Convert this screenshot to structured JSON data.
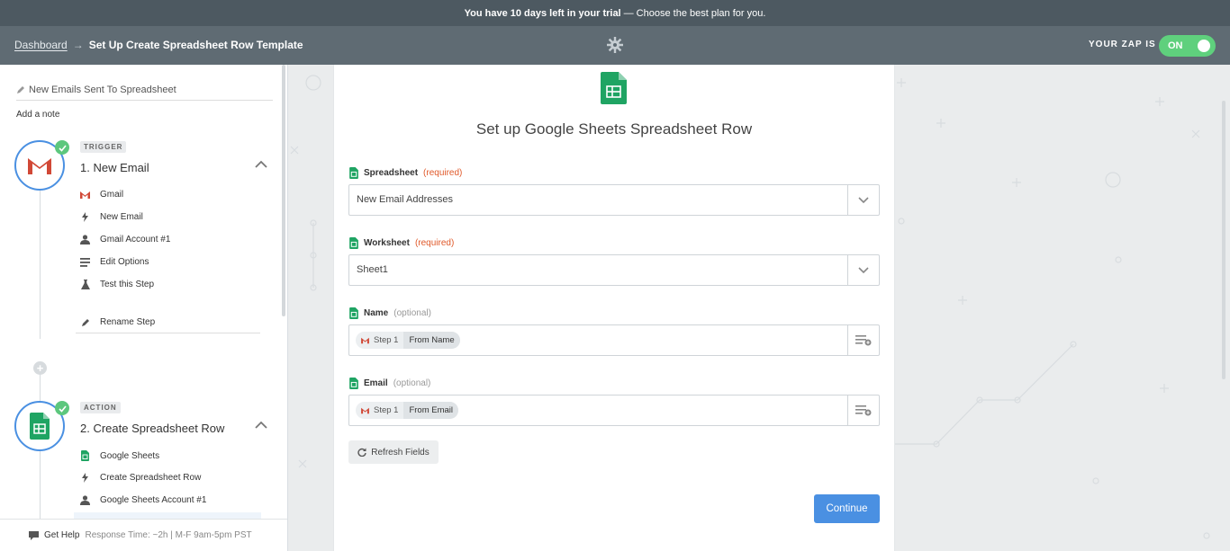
{
  "trial": {
    "bold": "You have 10 days left in your trial",
    "rest": "— Choose the best plan for you."
  },
  "header": {
    "dashboard": "Dashboard",
    "arrow": "→",
    "title": "Set Up Create Spreadsheet Row Template",
    "zap_is": "YOUR ZAP IS",
    "toggle": "ON"
  },
  "sidebar": {
    "zap_name": "New Emails Sent To Spreadsheet",
    "add_note": "Add a note",
    "step1": {
      "badge": "TRIGGER",
      "name": "1. New Email",
      "items": [
        "Gmail",
        "New Email",
        "Gmail Account #1",
        "Edit Options",
        "Test this Step"
      ],
      "rename": "Rename Step"
    },
    "step2": {
      "badge": "ACTION",
      "name": "2. Create Spreadsheet Row",
      "items": [
        "Google Sheets",
        "Create Spreadsheet Row",
        "Google Sheets Account #1"
      ]
    },
    "footer": {
      "help": "Get Help",
      "response": "Response Time: ~2h | M-F 9am-5pm PST"
    }
  },
  "card": {
    "title": "Set up Google Sheets Spreadsheet Row",
    "fields": [
      {
        "label": "Spreadsheet",
        "tag": "(required)",
        "value": "New Email Addresses"
      },
      {
        "label": "Worksheet",
        "tag": "(required)",
        "value": "Sheet1"
      },
      {
        "label": "Name",
        "tag": "(optional)",
        "step": "Step 1",
        "field": "From Name"
      },
      {
        "label": "Email",
        "tag": "(optional)",
        "step": "Step 1",
        "field": "From Email"
      }
    ],
    "refresh": "Refresh Fields",
    "continue": "Continue"
  },
  "colors": {
    "accent": "#4a90e2",
    "toggle": "#5fd07d",
    "sheets": "#1fa463",
    "gmail": "#d14836",
    "required": "#e0592a"
  }
}
